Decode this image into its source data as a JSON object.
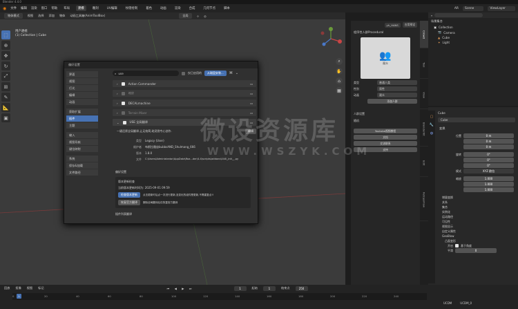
{
  "titlebar": {
    "title": "Blender 4.4.0"
  },
  "menubar": {
    "items": [
      "文件",
      "编辑",
      "渲染",
      "窗口",
      "帮助"
    ],
    "workspaces": [
      {
        "label": "布局",
        "active": false
      },
      {
        "label": "建模",
        "active": true
      },
      {
        "label": "雕刻",
        "active": false
      },
      {
        "label": "UV编辑",
        "active": false
      },
      {
        "label": "纹理绘制",
        "active": false
      },
      {
        "label": "着色",
        "active": false
      },
      {
        "label": "动画",
        "active": false
      },
      {
        "label": "渲染",
        "active": false
      },
      {
        "label": "合成",
        "active": false
      },
      {
        "label": "几何节点",
        "active": false
      },
      {
        "label": "脚本",
        "active": false
      }
    ],
    "scene": "Scene",
    "view_layer": "ViewLayer",
    "render_engine": "AR"
  },
  "header": {
    "mode": "物体模式",
    "items": [
      "视图",
      "选择",
      "添加",
      "物体"
    ],
    "toolbox": "动画工具箱(AnimToolBox)",
    "transform": "全局"
  },
  "viewport": {
    "line1": "用户透视",
    "line2": "(1) Collection | Cube"
  },
  "npanel": {
    "section": "程序性人群Procedural",
    "preview_label": "观众",
    "fields": [
      {
        "label": "类型",
        "value": "普通人类"
      },
      {
        "label": "性别",
        "value": "男性"
      },
      {
        "label": "动画",
        "value": "观众"
      }
    ],
    "add_button": "添加人群",
    "sub_sections": [
      "人群设置",
      "随机"
    ],
    "buttons": [
      "Youtube视频教程",
      "文档",
      "交流联系",
      "支持"
    ],
    "tab_labels": [
      "Tool",
      "View",
      "BlenderKit",
      "Crowd",
      "Edit",
      "RetopoFlow"
    ],
    "top_tabs": [
      "yh_HANS",
      "应用预设"
    ]
  },
  "outliner": {
    "title": "场景集合",
    "items": [
      {
        "label": "Collection",
        "icon": "collection-icon"
      },
      {
        "label": "Camera",
        "icon": "camera-icon"
      },
      {
        "label": "Cube",
        "icon": "cube-icon"
      },
      {
        "label": "Light",
        "icon": "light-icon"
      }
    ]
  },
  "props": {
    "object": "Cube",
    "sections": [
      "变换"
    ],
    "location_label": "位置",
    "loc": [
      "0 m",
      "0 m",
      "0 m"
    ],
    "rotation_label": "旋转",
    "rot": [
      "0°",
      "0°",
      "0°"
    ],
    "rot_mode_label": "模式",
    "rot_mode": "XYZ 欧拉",
    "scale_label": "缩放",
    "scale": [
      "1.000",
      "1.000",
      "1.000"
    ],
    "collapsed": [
      "增量变换",
      "关系",
      "集合",
      "实例化",
      "运动路径",
      "可见性",
      "视图显示",
      "自定义属性"
    ],
    "geo_section": "GeoBlow",
    "bump_label": "凸面变形",
    "open_label": "开启",
    "base_angle": "基于角度",
    "smooth_label": "平滑",
    "smooth_value": "0"
  },
  "dialog": {
    "title": "偏好设置",
    "sidebar_groups": [
      [
        "界面",
        "视图",
        "灯光",
        "编辑",
        "动画"
      ],
      [
        "获取扩展",
        "插件",
        "主题"
      ],
      [
        "输入",
        "视图导航",
        "键位映射"
      ],
      [
        "系统",
        "保存&加载",
        "文件路径"
      ]
    ],
    "active": "插件",
    "search_value": "use",
    "only_enabled": "仅已启用的",
    "install_button": "从磁盘安装...",
    "addons": [
      {
        "label": "Action Commander",
        "checked": true
      },
      {
        "label": "缩放",
        "checked": false
      },
      {
        "label": "DECALmachine",
        "checked": true
      },
      {
        "label": "Terrain Mixer",
        "checked": false
      },
      {
        "label": "USE 全局翻译",
        "checked": true
      }
    ],
    "desc": "一键还原全局翻译,让无效简,助灵隐专心创作.",
    "edit_button": "编辑",
    "info": [
      {
        "k": "类型",
        "v": "Legacy (User)"
      },
      {
        "k": "维护者",
        "v": "布斯拉雅宙bubbsAND_Shulmang_666"
      },
      {
        "k": "版本",
        "v": "1.8.0"
      },
      {
        "k": "文件",
        "v": "C:\\Users\\Administrator\\AppData\\Roa...der\\4.4\\scripts\\addons\\444\\_init__.py"
      }
    ],
    "prefs_title": "偏好设置",
    "update_title": "版本更新检查",
    "update_time": "当前版本更新时间为: 2025-09-01 09:59",
    "check_update": "检查版本更新",
    "check_desc": "点击更新时后点一次进行更新,没变化的组件是更新,不需重复点!!",
    "restore_button": "恢复官方翻译",
    "restore_desc": "删除全局翻译后仅恢复官方翻译",
    "footer": "插件列表翻译"
  },
  "watermark": {
    "cn": "微设资源库",
    "url": "WWW.WSZYK.COM"
  },
  "timeline": {
    "items": [
      "回放",
      "抠像",
      "视图",
      "标记"
    ],
    "frames": [
      "0",
      "20",
      "40",
      "60",
      "80",
      "100",
      "120",
      "140",
      "160",
      "180",
      "200",
      "220",
      "240"
    ],
    "current": "1",
    "start_label": "起始",
    "start": "1",
    "end_label": "结束点",
    "end": "250"
  },
  "status": {
    "left": "UCDM",
    "right": "UCDM_0"
  }
}
